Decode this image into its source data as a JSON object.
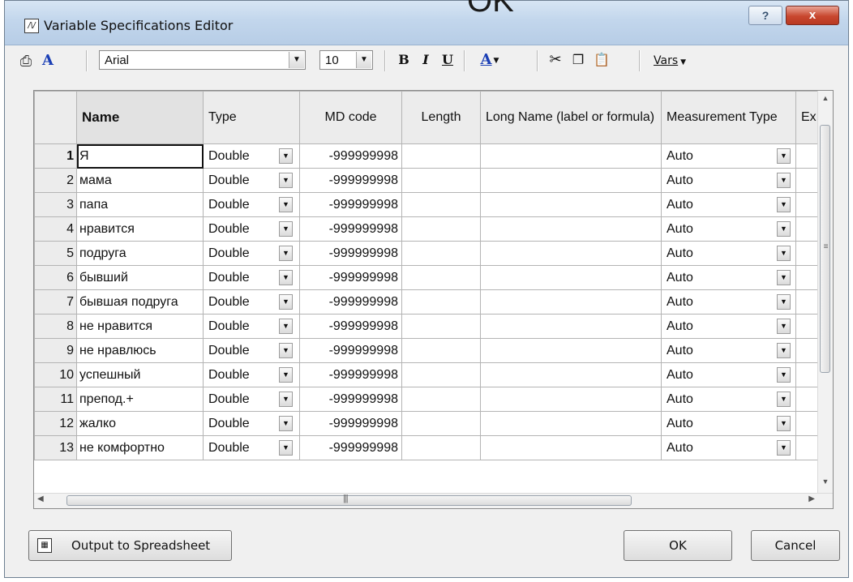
{
  "window": {
    "title": "Variable Specifications Editor",
    "ghost_title_fragment": "OK",
    "help_label": "?",
    "close_label": "x"
  },
  "toolbar": {
    "font_icon_label": "A",
    "font_name": "Arial",
    "font_size": "10",
    "bold_label": "B",
    "italic_label": "I",
    "underline_label": "U",
    "text_color_label": "A",
    "vars_label": "Vars"
  },
  "grid": {
    "columns": [
      "Name",
      "Type",
      "MD code",
      "Length",
      "Long Name (label or formula)",
      "Measurement Type",
      "Ex"
    ],
    "rows": [
      {
        "num": "1",
        "name": "Я",
        "type": "Double",
        "md_code": "-999999998",
        "length": "",
        "long_name": "",
        "measurement": "Auto"
      },
      {
        "num": "2",
        "name": "мама",
        "type": "Double",
        "md_code": "-999999998",
        "length": "",
        "long_name": "",
        "measurement": "Auto"
      },
      {
        "num": "3",
        "name": "папа",
        "type": "Double",
        "md_code": "-999999998",
        "length": "",
        "long_name": "",
        "measurement": "Auto"
      },
      {
        "num": "4",
        "name": "нравится",
        "type": "Double",
        "md_code": "-999999998",
        "length": "",
        "long_name": "",
        "measurement": "Auto"
      },
      {
        "num": "5",
        "name": "подруга",
        "type": "Double",
        "md_code": "-999999998",
        "length": "",
        "long_name": "",
        "measurement": "Auto"
      },
      {
        "num": "6",
        "name": "бывший",
        "type": "Double",
        "md_code": "-999999998",
        "length": "",
        "long_name": "",
        "measurement": "Auto"
      },
      {
        "num": "7",
        "name": "бывшая подруга",
        "type": "Double",
        "md_code": "-999999998",
        "length": "",
        "long_name": "",
        "measurement": "Auto"
      },
      {
        "num": "8",
        "name": "не нравится",
        "type": "Double",
        "md_code": "-999999998",
        "length": "",
        "long_name": "",
        "measurement": "Auto"
      },
      {
        "num": "9",
        "name": "не нравлюсь",
        "type": "Double",
        "md_code": "-999999998",
        "length": "",
        "long_name": "",
        "measurement": "Auto"
      },
      {
        "num": "10",
        "name": "успешный",
        "type": "Double",
        "md_code": "-999999998",
        "length": "",
        "long_name": "",
        "measurement": "Auto"
      },
      {
        "num": "11",
        "name": "препод.+",
        "type": "Double",
        "md_code": "-999999998",
        "length": "",
        "long_name": "",
        "measurement": "Auto"
      },
      {
        "num": "12",
        "name": "жалко",
        "type": "Double",
        "md_code": "-999999998",
        "length": "",
        "long_name": "",
        "measurement": "Auto"
      },
      {
        "num": "13",
        "name": "не комфортно",
        "type": "Double",
        "md_code": "-999999998",
        "length": "",
        "long_name": "",
        "measurement": "Auto"
      }
    ],
    "active_row": 1
  },
  "buttons": {
    "output": "Output to Spreadsheet",
    "ok": "OK",
    "cancel": "Cancel"
  },
  "icons": {
    "print": "print-icon",
    "font": "font-icon",
    "cut": "scissors-icon",
    "copy": "copy-icon",
    "paste": "paste-icon",
    "spreadsheet": "spreadsheet-icon"
  },
  "colors": {
    "titlebar": "#c2d6ec",
    "close_button": "#c8472f",
    "font_icon": "#1b3fb5"
  }
}
